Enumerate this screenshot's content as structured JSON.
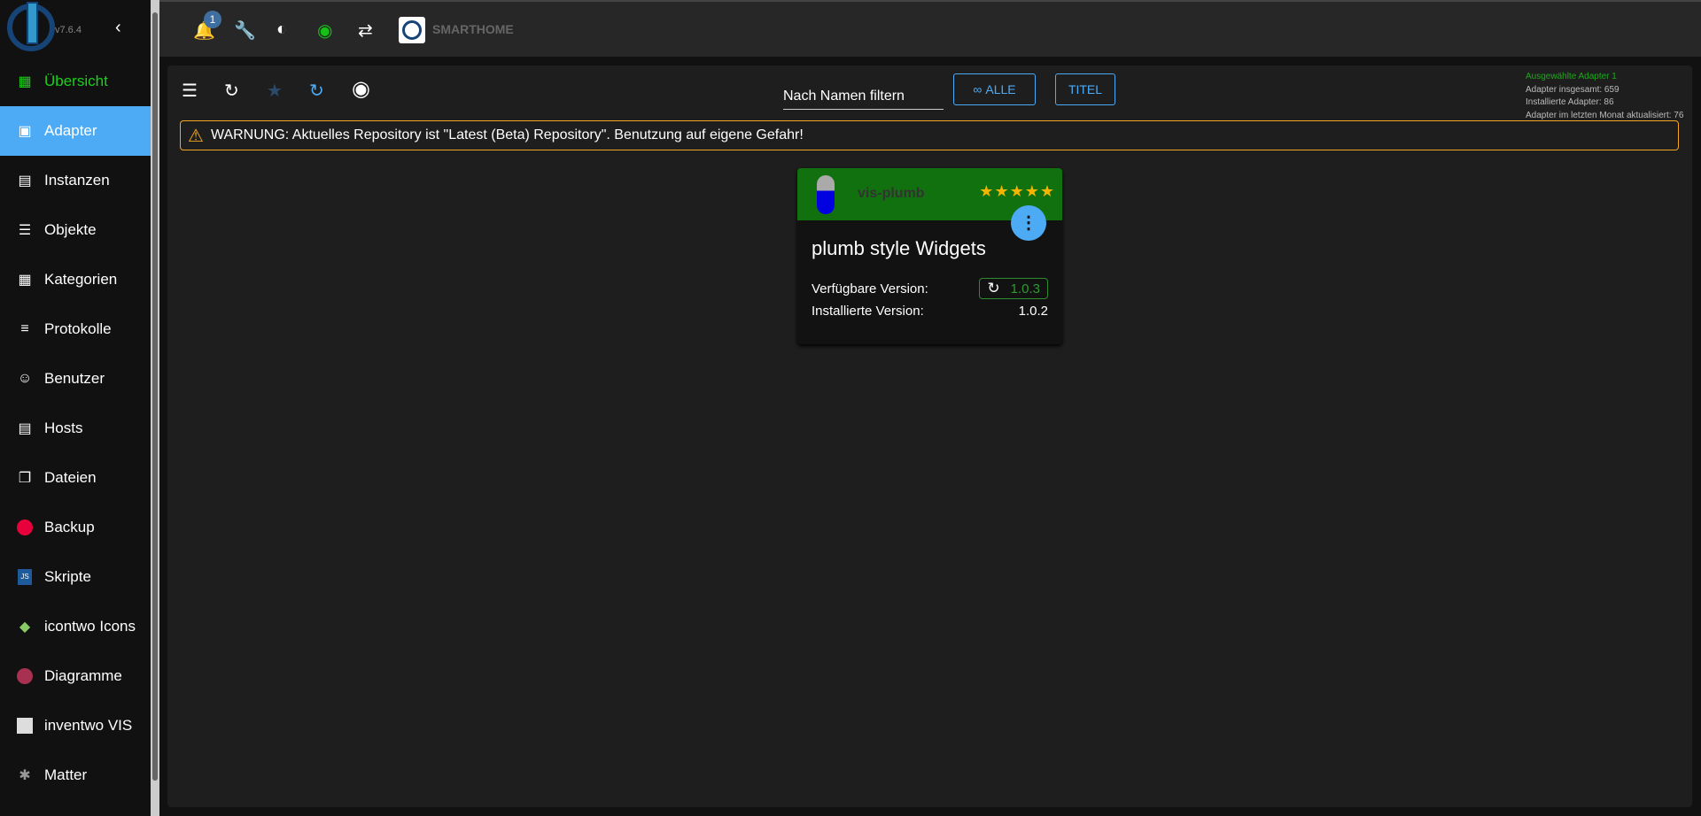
{
  "sidebar": {
    "version": "v7.6.4",
    "items": [
      {
        "label": "Übersicht",
        "icon": "grid-icon"
      },
      {
        "label": "Adapter",
        "icon": "store-icon"
      },
      {
        "label": "Instanzen",
        "icon": "instances-icon"
      },
      {
        "label": "Objekte",
        "icon": "list-icon"
      },
      {
        "label": "Kategorien",
        "icon": "categories-icon"
      },
      {
        "label": "Protokolle",
        "icon": "log-icon"
      },
      {
        "label": "Benutzer",
        "icon": "user-icon"
      },
      {
        "label": "Hosts",
        "icon": "server-icon"
      },
      {
        "label": "Dateien",
        "icon": "files-icon"
      },
      {
        "label": "Backup",
        "icon": "backup-icon"
      },
      {
        "label": "Skripte",
        "icon": "javascript-icon"
      },
      {
        "label": "icontwo Icons",
        "icon": "icontwo-icon"
      },
      {
        "label": "Diagramme",
        "icon": "charts-icon"
      },
      {
        "label": "inventwo VIS",
        "icon": "inventwo-icon"
      },
      {
        "label": "Matter",
        "icon": "matter-icon"
      }
    ]
  },
  "topbar": {
    "notifications": "1",
    "brand": "SMARTHOME"
  },
  "toolbar": {
    "filter_placeholder": "Nach Namen filtern",
    "all_label": "ALLE",
    "title_label": "TITEL"
  },
  "stats": {
    "selected": "Ausgewählte Adapter 1",
    "total": "Adapter insgesamt: 659",
    "installed": "Installierte Adapter: 86",
    "updated": "Adapter im letzten Monat aktualisiert: 76"
  },
  "warning": "WARNUNG: Aktuelles Repository ist \"Latest (Beta) Repository\". Benutzung auf eigene Gefahr!",
  "card": {
    "name": "vis-plumb",
    "rating": 5,
    "title": "plumb style Widgets",
    "available_label": "Verfügbare Version:",
    "available": "1.0.3",
    "installed_label": "Installierte Version:",
    "installed": "1.0.2"
  }
}
